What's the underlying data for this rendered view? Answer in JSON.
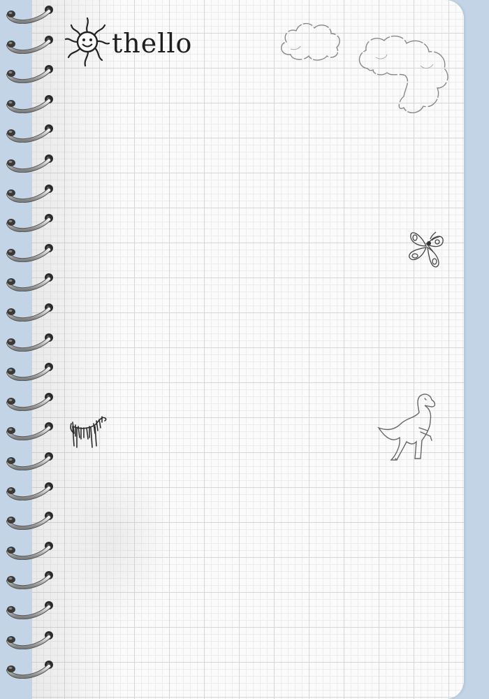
{
  "app": {
    "logo_text": "thello",
    "logo_icon": "smiling-sun-icon"
  },
  "notebook": {
    "page_color": "#fbfbfb",
    "background_color": "#c3d4e6",
    "ring_count": 23,
    "doodles": [
      {
        "name": "cloud-small-doodle",
        "icon": "cloud-icon"
      },
      {
        "name": "cloud-large-doodle",
        "icon": "cloud-icon"
      },
      {
        "name": "butterfly-doodle",
        "icon": "butterfly-icon"
      },
      {
        "name": "zebra-doodle",
        "icon": "zebra-icon"
      },
      {
        "name": "dinosaur-doodle",
        "icon": "dinosaur-icon"
      }
    ]
  }
}
